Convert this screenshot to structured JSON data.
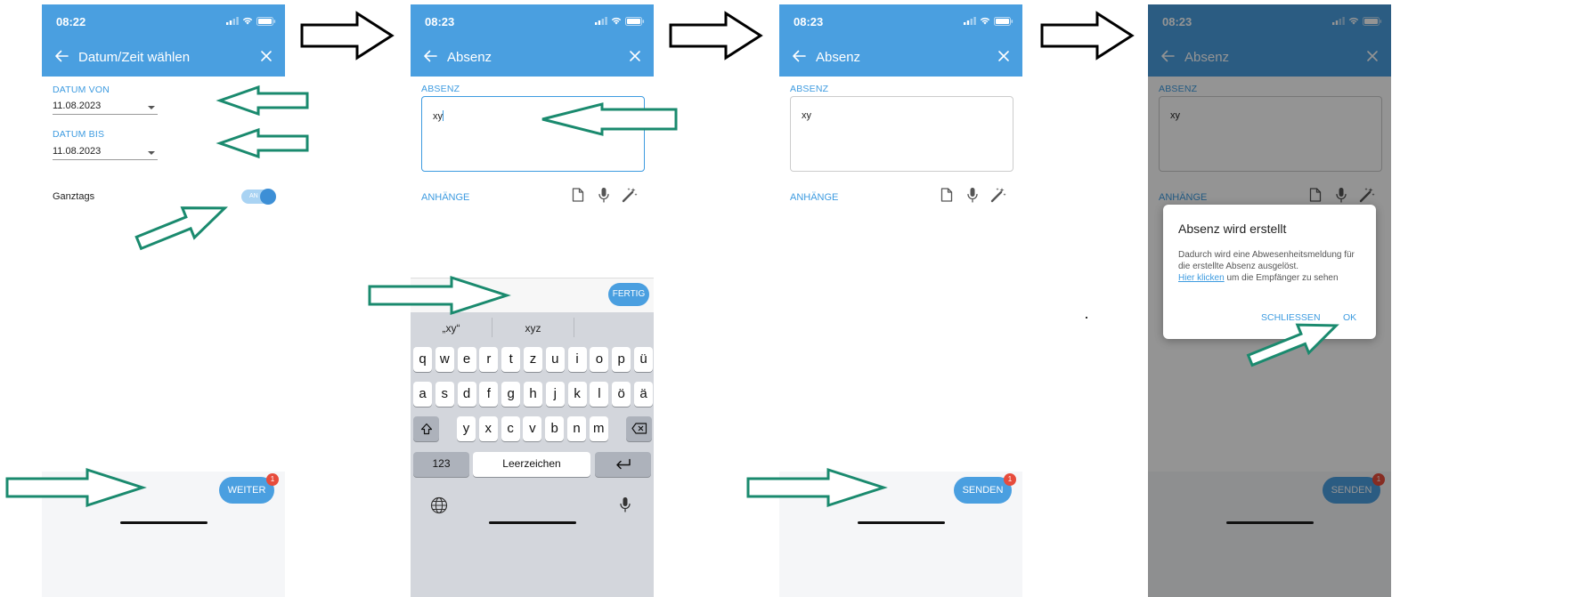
{
  "colors": {
    "primary": "#4a9fe0",
    "badge": "#e74c3c",
    "annotation_arrow": "#1a8a6e",
    "flow_arrow": "#000000"
  },
  "screen1": {
    "time": "08:22",
    "title": "Datum/Zeit wählen",
    "datum_von_label": "DATUM VON",
    "datum_von_value": "11.08.2023",
    "datum_bis_label": "DATUM BIS",
    "datum_bis_value": "11.08.2023",
    "ganztags_label": "Ganztags",
    "toggle_state": "AN",
    "next_button": "WEITER",
    "badge": "1"
  },
  "screen2": {
    "time": "08:23",
    "title": "Absenz",
    "field_label": "ABSENZ",
    "field_value": "xy",
    "attachments_label": "ANHÄNGE",
    "done_button": "FERTIG",
    "suggestions": [
      "„xy“",
      "xyz",
      ""
    ],
    "rows": {
      "row1": [
        "q",
        "w",
        "e",
        "r",
        "t",
        "z",
        "u",
        "i",
        "o",
        "p",
        "ü"
      ],
      "row2": [
        "a",
        "s",
        "d",
        "f",
        "g",
        "h",
        "j",
        "k",
        "l",
        "ö",
        "ä"
      ],
      "row3": [
        "y",
        "x",
        "c",
        "v",
        "b",
        "n",
        "m"
      ]
    },
    "numbers_key": "123",
    "space_key": "Leerzeichen"
  },
  "screen3": {
    "time": "08:23",
    "title": "Absenz",
    "field_label": "ABSENZ",
    "field_value": "xy",
    "attachments_label": "ANHÄNGE",
    "send_button": "SENDEN",
    "badge": "1"
  },
  "screen4": {
    "time": "08:23",
    "title": "Absenz",
    "field_label": "ABSENZ",
    "field_value": "xy",
    "attachments_label": "ANHÄNGE",
    "send_button": "SENDEN",
    "badge": "1",
    "dialog": {
      "title": "Absenz wird erstellt",
      "body": "Dadurch wird eine Abwesenheitsmeldung für die erstellte Absenz ausgelöst.",
      "link": "Hier klicken",
      "link_suffix": " um die Empfänger zu sehen",
      "cancel": "SCHLIESSEN",
      "ok": "OK"
    }
  }
}
